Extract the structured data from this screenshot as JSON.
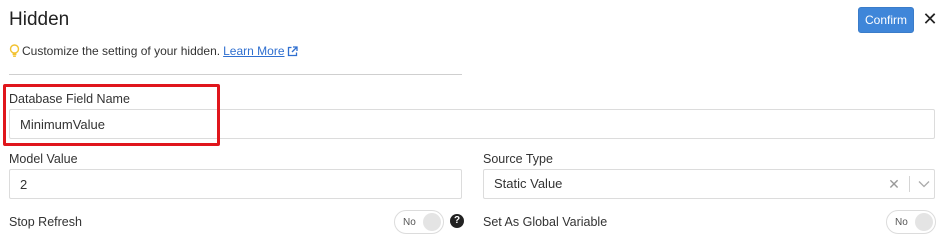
{
  "header": {
    "title": "Hidden",
    "confirm_label": "Confirm",
    "close_icon": "close-icon",
    "confirm_color": "#3f86d9"
  },
  "hint": {
    "icon": "lightbulb-icon",
    "text": "Customize the setting of your hidden.",
    "link_text": "Learn More",
    "link_icon": "external-link-icon",
    "link_color": "#2f6fd0"
  },
  "fields": {
    "database_field_name": {
      "label": "Database Field Name",
      "value": "MinimumValue",
      "highlight_color": "#e0161c"
    },
    "model_value": {
      "label": "Model Value",
      "value": "2"
    },
    "source_type": {
      "label": "Source Type",
      "value": "Static Value",
      "clear_icon": "clear-icon",
      "dropdown_icon": "chevron-down-icon"
    },
    "stop_refresh": {
      "label": "Stop Refresh",
      "toggle_text": "No",
      "help_icon": "question-icon",
      "help_glyph": "?"
    },
    "set_as_global_variable": {
      "label": "Set As Global Variable",
      "toggle_text": "No"
    }
  }
}
